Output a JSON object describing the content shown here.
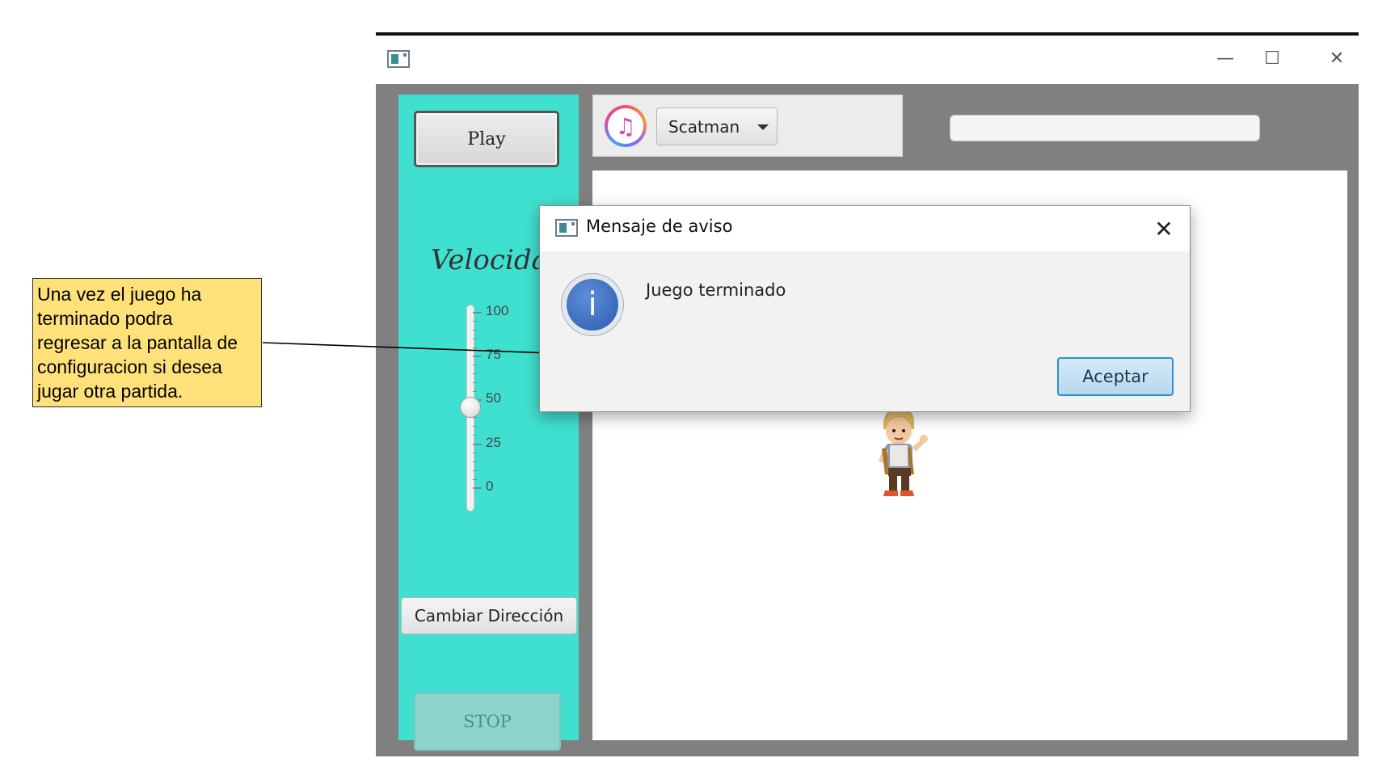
{
  "annotation": {
    "lines": [
      "Una vez el juego ha",
      "terminado podra",
      "regresar a la pantalla de",
      "configuracion si desea",
      "jugar otra partida."
    ]
  },
  "window": {
    "app_icon": "window-app-icon",
    "controls": {
      "minimize": "—",
      "maximize": "☐",
      "close": "✕"
    }
  },
  "sidebar": {
    "play_label": "Play",
    "speed_label": "Velocidad",
    "speed_value": 50,
    "speed_ticks": [
      "100",
      "75",
      "50",
      "25",
      "0"
    ],
    "direction_label": "Cambiar Dirección",
    "stop_label": "STOP"
  },
  "music": {
    "icon": "music-note-icon",
    "selected_song": "Scatman"
  },
  "dialog": {
    "title": "Mensaje de aviso",
    "close": "✕",
    "icon": "info-icon",
    "icon_glyph": "i",
    "message": "Juego terminado",
    "ok_label": "Aceptar"
  },
  "colors": {
    "sidebar": "#40e0d0",
    "window_frame": "#808080",
    "note_background": "#ffe179",
    "dialog_button_border": "#2b8fd8"
  }
}
